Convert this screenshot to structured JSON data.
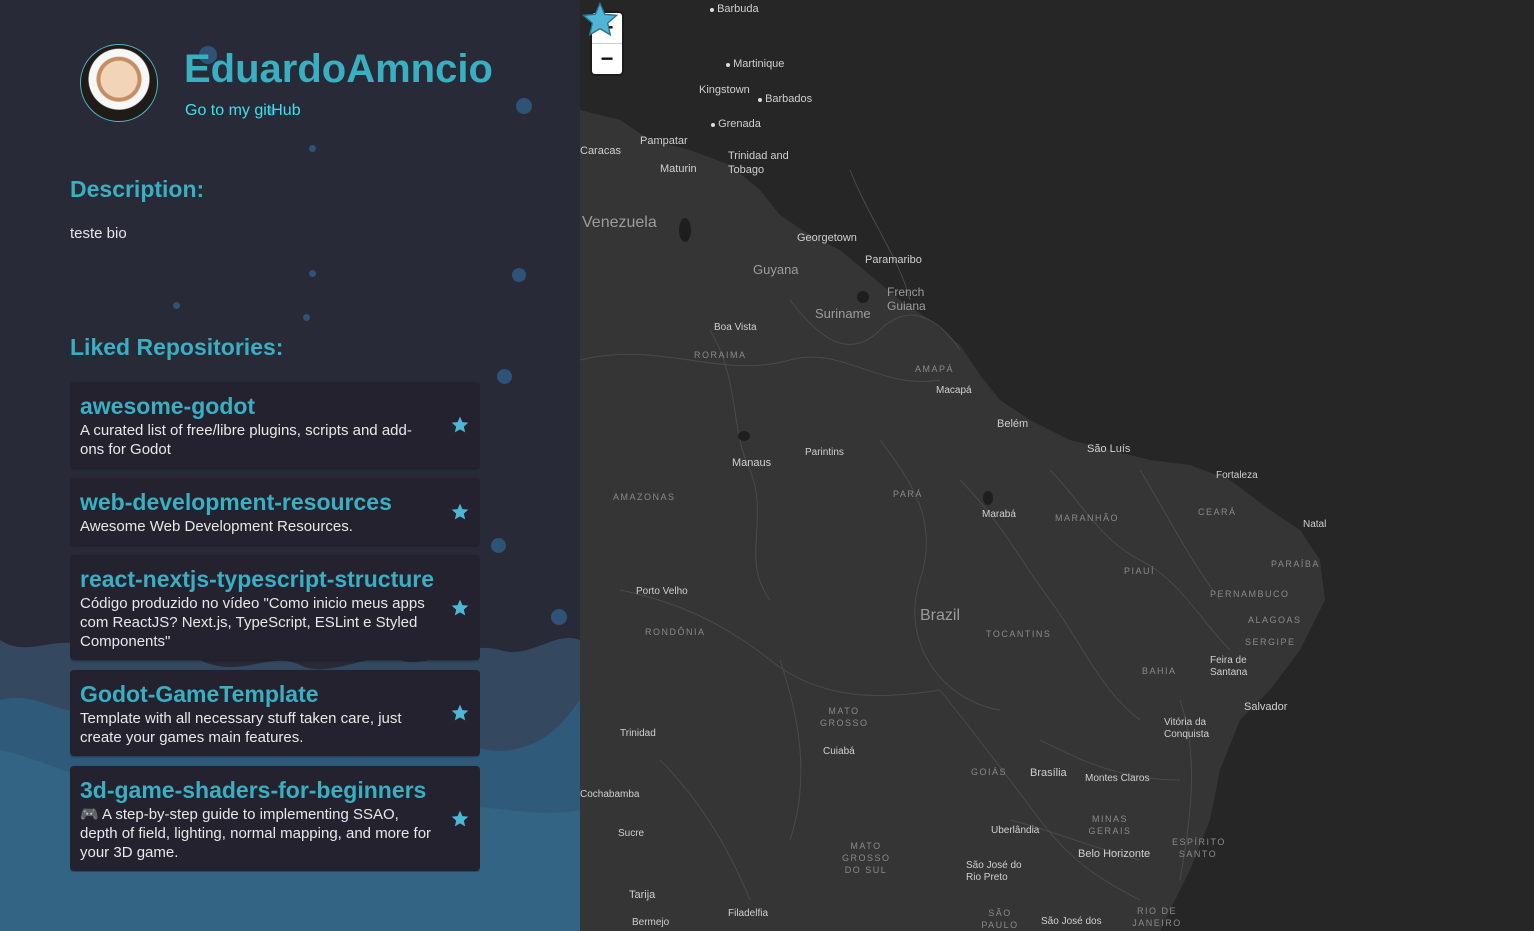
{
  "profile": {
    "name": "EduardoAmncio",
    "github_link": "Go to my gitHub"
  },
  "sections": {
    "description_title": "Description:",
    "bio": "teste bio",
    "liked_title": "Liked Repositories:"
  },
  "repos": [
    {
      "name": "awesome-godot",
      "description": "A curated list of free/libre plugins, scripts and add-ons for Godot"
    },
    {
      "name": "web-development-resources",
      "description": "Awesome Web Development Resources."
    },
    {
      "name": "react-nextjs-typescript-structure",
      "description": "Código produzido no vídeo \"Como inicio meus apps com ReactJS? Next.js, TypeScript, ESLint e Styled Components\""
    },
    {
      "name": "Godot-GameTemplate",
      "description": "Template with all necessary stuff taken care, just create your games main features."
    },
    {
      "name": "3d-game-shaders-for-beginners",
      "description": "🎮 A step-by-step guide to implementing SSAO, depth of field, lighting, normal mapping, and more for your 3D game."
    }
  ],
  "map": {
    "zoom_in": "+",
    "zoom_out": "−",
    "countries": [
      "Venezuela",
      "Guyana",
      "Suriname",
      "French Guiana",
      "Brazil"
    ],
    "places": [
      "Barbuda",
      "Martinique",
      "Kingstown",
      "Barbados",
      "Grenada",
      "Pampatar",
      "Caracas",
      "Maturin",
      "Trinidad and Tobago",
      "Georgetown",
      "Paramaribo",
      "Boa Vista",
      "Macapá",
      "Belém",
      "São Luís",
      "Fortaleza",
      "Manaus",
      "Parintins",
      "Marabá",
      "Natal",
      "Porto Velho",
      "Feira de Santana",
      "Salvador",
      "Trinidad",
      "Cuiabá",
      "Brasília",
      "Montes Claros",
      "Vitória da Conquista",
      "Cochabamba",
      "Sucre",
      "Uberlândia",
      "Belo Horizonte",
      "São José do Rio Preto",
      "Tarija",
      "Filadelfia",
      "Bermejo",
      "São José dos"
    ],
    "regions": [
      "RORAIMA",
      "AMAPÁ",
      "AMAZONAS",
      "PARÁ",
      "MARANHÃO",
      "CEARÁ",
      "PIAUÍ",
      "PARAÍBA",
      "PERNAMBUCO",
      "ALAGOAS",
      "SERGIPE",
      "RONDÔNIA",
      "TOCANTINS",
      "BAHIA",
      "MATO GROSSO",
      "GOIÁS",
      "MINAS GERAIS",
      "ESPÍRITO SANTO",
      "MATO GROSSO DO SUL",
      "SÃO PAULO",
      "RIO DE JANEIRO"
    ]
  },
  "colors": {
    "accent": "#3aafc2",
    "link": "#3de0ee",
    "star": "#4fb6d6",
    "sidebar": "#282a38",
    "card": "#24222f"
  }
}
